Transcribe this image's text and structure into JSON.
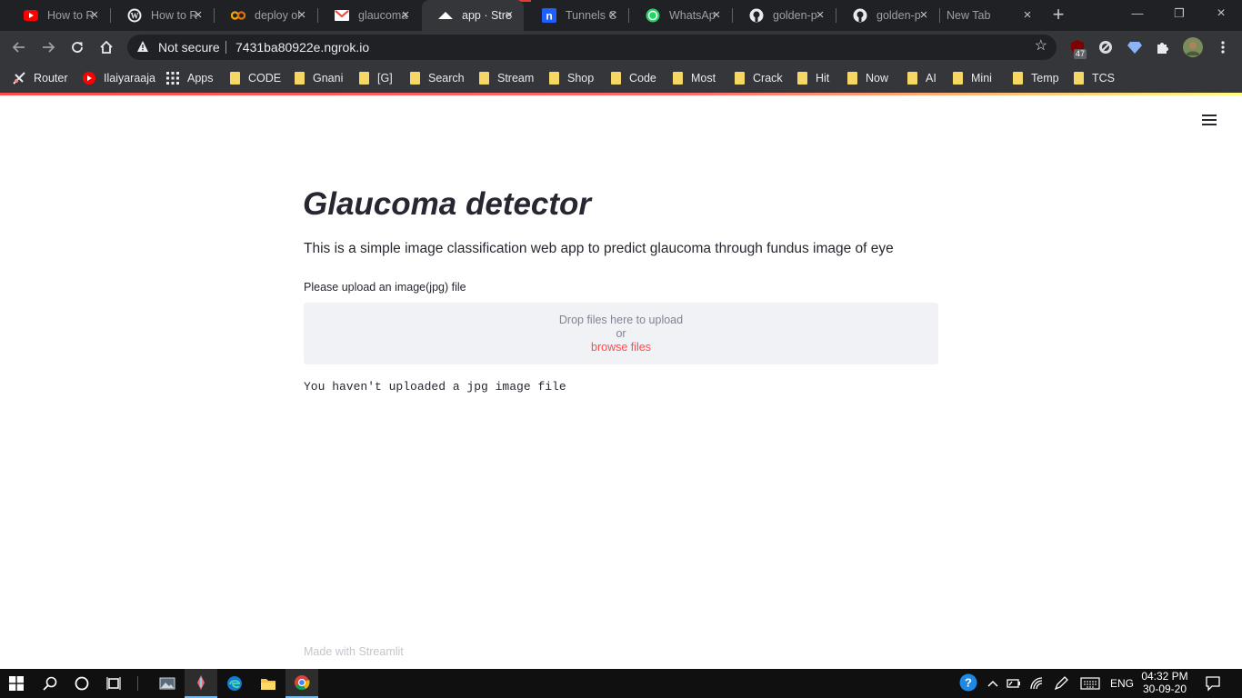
{
  "browser": {
    "tabs": [
      {
        "title": "How to R",
        "icon": "youtube-icon"
      },
      {
        "title": "How to R",
        "icon": "wordpress-icon"
      },
      {
        "title": "deploy ol",
        "icon": "colab-icon"
      },
      {
        "title": "glaucoma",
        "icon": "gmail-icon"
      },
      {
        "title": "app · Stre",
        "icon": "streamlit-icon",
        "active": true
      },
      {
        "title": "Tunnels C",
        "icon": "ngrok-icon"
      },
      {
        "title": "WhatsAp",
        "icon": "whatsapp-icon"
      },
      {
        "title": "golden-p",
        "icon": "github-icon"
      },
      {
        "title": "golden-p",
        "icon": "github-icon"
      },
      {
        "title": "New Tab",
        "icon": ""
      }
    ],
    "security_label": "Not secure",
    "url": "7431ba80922e.ngrok.io",
    "extension_badge": "47",
    "bookmarks": [
      {
        "label": "Router",
        "icon": "router-icon"
      },
      {
        "label": "Ilaiyaraaja",
        "icon": "youtube-icon"
      },
      {
        "label": "Apps",
        "icon": "apps-grid-icon"
      },
      {
        "label": "CODE",
        "icon": "folder-icon"
      },
      {
        "label": "Gnani",
        "icon": "folder-icon"
      },
      {
        "label": "[G]",
        "icon": "folder-icon"
      },
      {
        "label": "Search",
        "icon": "folder-icon"
      },
      {
        "label": "Stream",
        "icon": "folder-icon"
      },
      {
        "label": "Shop",
        "icon": "folder-icon"
      },
      {
        "label": "Code",
        "icon": "folder-icon"
      },
      {
        "label": "Most",
        "icon": "folder-icon"
      },
      {
        "label": "Crack",
        "icon": "folder-icon"
      },
      {
        "label": "Hit",
        "icon": "folder-icon"
      },
      {
        "label": "Now",
        "icon": "folder-icon"
      },
      {
        "label": "AI",
        "icon": "folder-icon"
      },
      {
        "label": "Mini",
        "icon": "folder-icon"
      },
      {
        "label": "Temp",
        "icon": "folder-icon"
      },
      {
        "label": "TCS",
        "icon": "folder-icon"
      }
    ]
  },
  "app": {
    "title": "Glaucoma detector",
    "description": "This is a simple image classification web app to predict glaucoma through fundus image of eye",
    "uploader": {
      "label": "Please upload an image(jpg) file",
      "drop_text": "Drop files here to upload",
      "or_text": "or",
      "browse_text": "browse files"
    },
    "status_message": "You haven't uploaded a jpg image file",
    "footer": "Made with Streamlit",
    "accent_color": "#ff4b4b"
  },
  "taskbar": {
    "language": "ENG",
    "time": "04:32 PM",
    "date": "30-09-20"
  }
}
